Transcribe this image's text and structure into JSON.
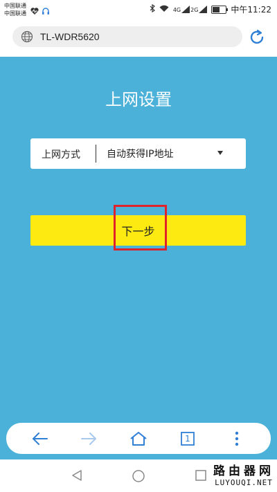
{
  "status_bar": {
    "carrier1": "中国联通",
    "carrier2": "中国联通",
    "signal1_label": "4G",
    "signal2_label": "2G",
    "time": "中午11:22",
    "battery_level": 0.5
  },
  "browser": {
    "url": "TL-WDR5620"
  },
  "page": {
    "title": "上网设置",
    "connection_label": "上网方式",
    "connection_value": "自动获得IP地址",
    "next_button": "下一步"
  },
  "toolbar": {
    "tab_count": "1"
  },
  "watermark": {
    "top": "路由器网",
    "bottom": "LUYOUQI.NET"
  },
  "colors": {
    "page_background": "#4bb1d9",
    "button": "#fcea10",
    "highlight": "#e0232a",
    "toolbar_icons": "#2f7fd6"
  },
  "icons": [
    "heart-rate-icon",
    "headset-icon",
    "bluetooth-icon",
    "wifi-icon",
    "signal-icon",
    "battery-icon",
    "globe-icon",
    "refresh-icon",
    "back-arrow-icon",
    "forward-arrow-icon",
    "home-icon",
    "tabs-icon",
    "more-icon",
    "nav-back-icon",
    "nav-home-icon",
    "nav-recents-icon"
  ]
}
